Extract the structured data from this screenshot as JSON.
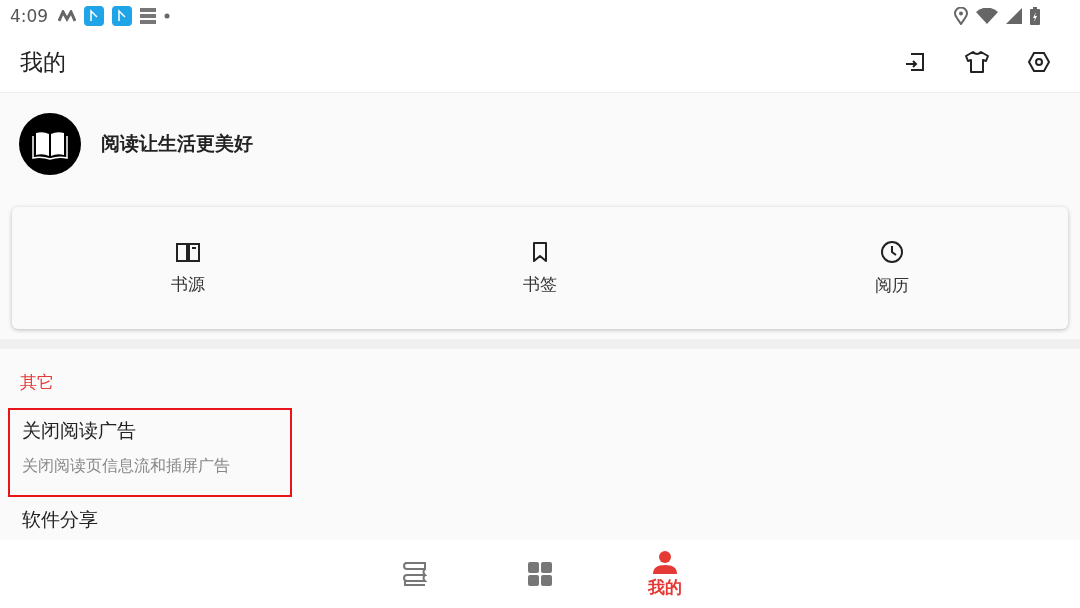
{
  "status_bar": {
    "time": "4:09"
  },
  "app_bar": {
    "title": "我的"
  },
  "profile": {
    "motto": "阅读让生活更美好"
  },
  "shortcuts": [
    {
      "kind": "book",
      "label": "书源"
    },
    {
      "kind": "bookmark",
      "label": "书签"
    },
    {
      "kind": "clock",
      "label": "阅历"
    }
  ],
  "section": {
    "title": "其它",
    "items": [
      {
        "title": "关闭阅读广告",
        "subtitle": "关闭阅读页信息流和插屏广告",
        "highlighted": true
      },
      {
        "title": "软件分享",
        "highlighted": false
      }
    ]
  },
  "bottom_nav": [
    {
      "kind": "bookshelf",
      "selected": false
    },
    {
      "kind": "discover",
      "selected": false
    },
    {
      "kind": "mine",
      "label": "我的",
      "selected": true
    }
  ]
}
